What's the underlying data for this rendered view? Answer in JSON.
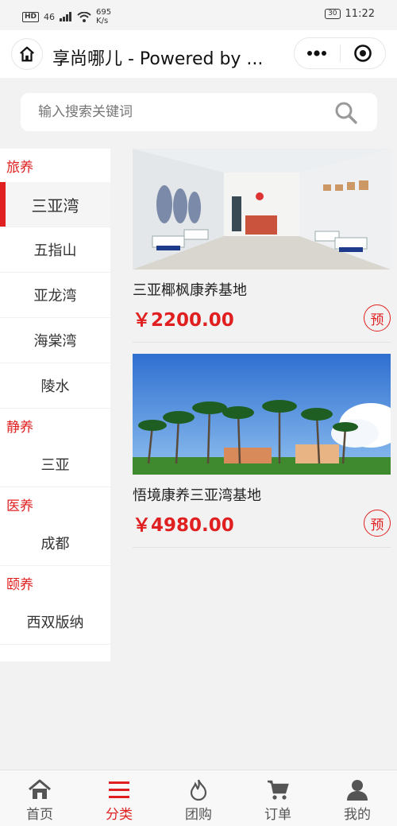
{
  "status": {
    "network": "46",
    "speed": "695",
    "speed_unit": "K/s",
    "battery": "30",
    "time": "11:22"
  },
  "header": {
    "title": "享尚哪儿 - Powered by ..."
  },
  "search": {
    "placeholder": "输入搜索关键词"
  },
  "sidebar": {
    "groups": [
      {
        "title": "旅养",
        "items": [
          "三亚湾",
          "五指山",
          "亚龙湾",
          "海棠湾",
          "陵水"
        ]
      },
      {
        "title": "静养",
        "items": [
          "三亚"
        ]
      },
      {
        "title": "医养",
        "items": [
          "成都"
        ]
      },
      {
        "title": "颐养",
        "items": [
          "西双版纳"
        ]
      }
    ],
    "active": "三亚湾"
  },
  "products": [
    {
      "name": "三亚椰枫康养基地",
      "price": "￥2200.00",
      "book_label": "预"
    },
    {
      "name": "悟境康养三亚湾基地",
      "price": "￥4980.00",
      "book_label": "预"
    }
  ],
  "tabbar": {
    "items": [
      {
        "label": "首页",
        "icon": "home-icon"
      },
      {
        "label": "分类",
        "icon": "menu-icon"
      },
      {
        "label": "团购",
        "icon": "flame-icon"
      },
      {
        "label": "订单",
        "icon": "cart-icon"
      },
      {
        "label": "我的",
        "icon": "user-icon"
      }
    ],
    "active_index": 1,
    "accent_color": "#e02020"
  }
}
